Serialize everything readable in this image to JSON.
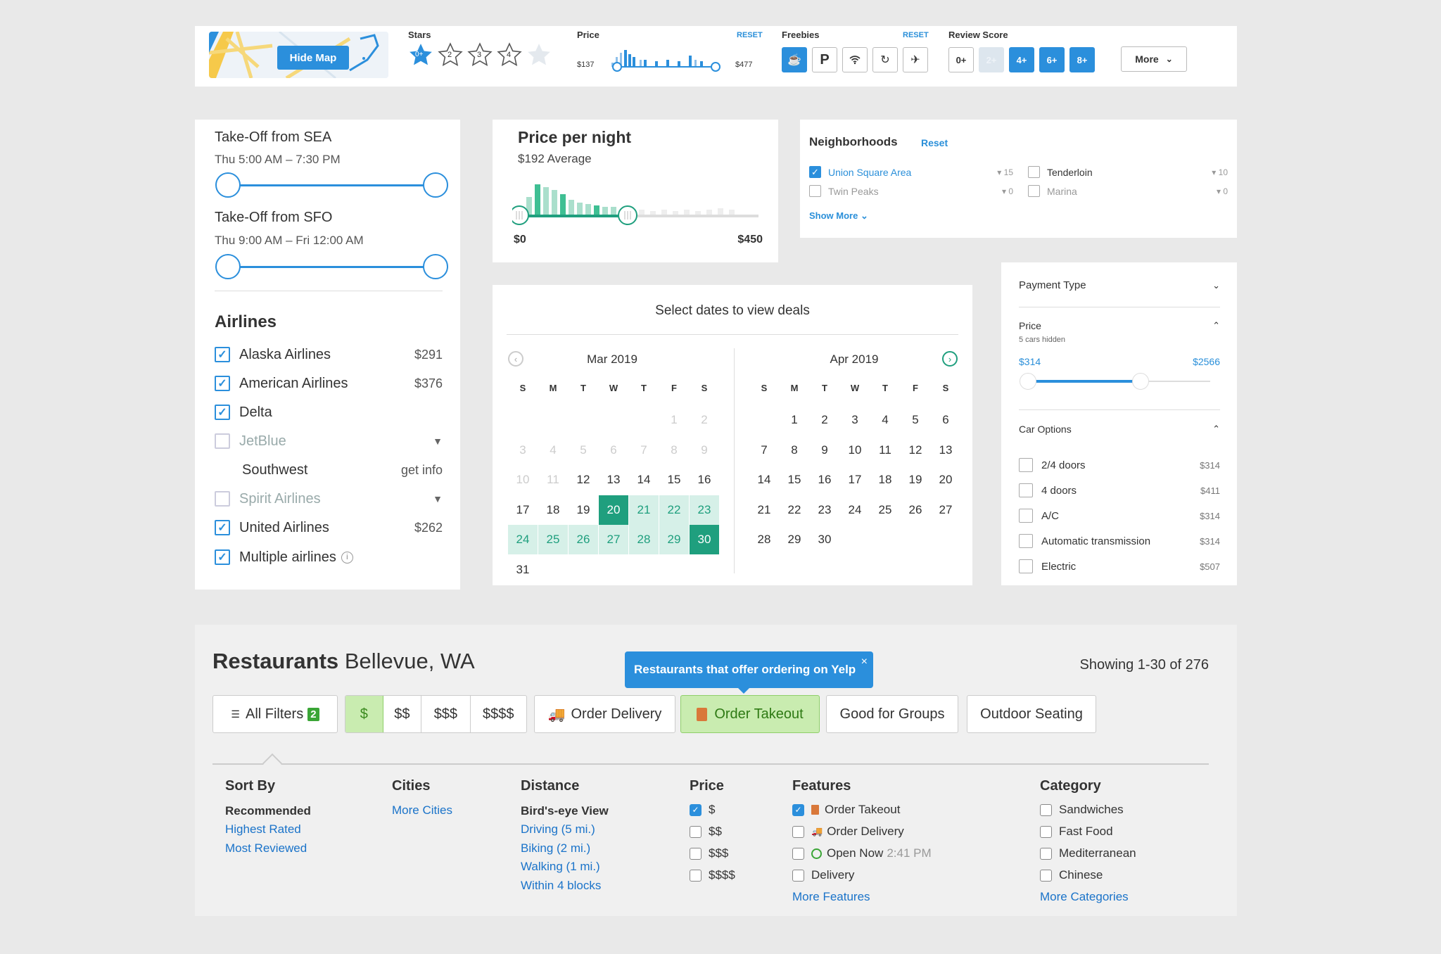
{
  "topbar": {
    "hide_map": "Hide Map",
    "stars_label": "Stars",
    "stars": [
      "0+",
      "2",
      "3",
      "4",
      ""
    ],
    "price_label": "Price",
    "price_reset": "RESET",
    "price_min": "$137",
    "price_max": "$477",
    "freebies_label": "Freebies",
    "freebies_reset": "RESET",
    "freebies_icons": [
      "breakfast-icon",
      "parking-icon",
      "wifi-icon",
      "shuttle-icon",
      "airport-icon"
    ],
    "parking_letter": "P",
    "review_label": "Review Score",
    "review": [
      "0+",
      "2+",
      "4+",
      "6+",
      "8+"
    ],
    "more": "More"
  },
  "flights": {
    "sea_title": "Take-Off from SEA",
    "sea_time": "Thu 5:00 AM – 7:30 PM",
    "sfo_title": "Take-Off from SFO",
    "sfo_time": "Thu 9:00 AM – Fri 12:00 AM",
    "airlines_title": "Airlines",
    "airlines": [
      {
        "name": "Alaska Airlines",
        "price": "$291"
      },
      {
        "name": "American Airlines",
        "price": "$376"
      },
      {
        "name": "Delta",
        "price": ""
      },
      {
        "name": "JetBlue",
        "price": ""
      },
      {
        "name": "Southwest",
        "price": "get info"
      },
      {
        "name": "Spirit Airlines",
        "price": ""
      },
      {
        "name": "United Airlines",
        "price": "$262"
      },
      {
        "name": "Multiple airlines",
        "price": ""
      }
    ]
  },
  "ppn": {
    "title": "Price per night",
    "avg": "$192 Average",
    "min": "$0",
    "max": "$450"
  },
  "neighborhoods": {
    "title": "Neighborhoods",
    "reset": "Reset",
    "items": [
      {
        "name": "Union Square Area",
        "count": "15"
      },
      {
        "name": "Twin Peaks",
        "count": "0"
      },
      {
        "name": "Tenderloin",
        "count": "10"
      },
      {
        "name": "Marina",
        "count": "0"
      }
    ],
    "show_more": "Show More"
  },
  "calendar": {
    "title": "Select dates to view deals",
    "left_month": "Mar 2019",
    "right_month": "Apr 2019",
    "dow": [
      "S",
      "M",
      "T",
      "W",
      "T",
      "F",
      "S"
    ]
  },
  "car": {
    "payment": "Payment Type",
    "price": "Price",
    "hidden": "5 cars hidden",
    "min": "$314",
    "max": "$2566",
    "options": "Car Options",
    "items": [
      {
        "name": "2/4 doors",
        "price": "$314"
      },
      {
        "name": "4 doors",
        "price": "$411"
      },
      {
        "name": "A/C",
        "price": "$314"
      },
      {
        "name": "Automatic transmission",
        "price": "$314"
      },
      {
        "name": "Electric",
        "price": "$507"
      }
    ]
  },
  "restaurants": {
    "title_bold": "Restaurants",
    "title_loc": "Bellevue, WA",
    "tooltip": "Restaurants that offer ordering on Yelp",
    "tooltip_close": "×",
    "showing": "Showing 1-30 of 276",
    "all_filters": "All Filters",
    "filter_count": "2",
    "prices": [
      "$",
      "$$",
      "$$$",
      "$$$$"
    ],
    "order_delivery": "Order Delivery",
    "order_takeout": "Order Takeout",
    "good_groups": "Good for Groups",
    "outdoor": "Outdoor Seating",
    "sort_by": "Sort By",
    "sort": [
      "Recommended",
      "Highest Rated",
      "Most Reviewed"
    ],
    "cities": "Cities",
    "more_cities": "More Cities",
    "distance": "Distance",
    "dist": [
      "Bird's-eye View",
      "Driving (5 mi.)",
      "Biking (2 mi.)",
      "Walking (1 mi.)",
      "Within 4 blocks"
    ],
    "price": "Price",
    "features": "Features",
    "feat": [
      "Order Takeout",
      "Order Delivery",
      "Open Now",
      "Delivery"
    ],
    "open_time": "2:41 PM",
    "more_features": "More Features",
    "category": "Category",
    "cats": [
      "Sandwiches",
      "Fast Food",
      "Mediterranean",
      "Chinese"
    ],
    "more_categories": "More Categories"
  },
  "colors": {
    "blue": "#2b8fdc",
    "teal": "#1f9f7e",
    "yelp_green": "#c9ecb0",
    "bg": "#e9e9e9"
  }
}
